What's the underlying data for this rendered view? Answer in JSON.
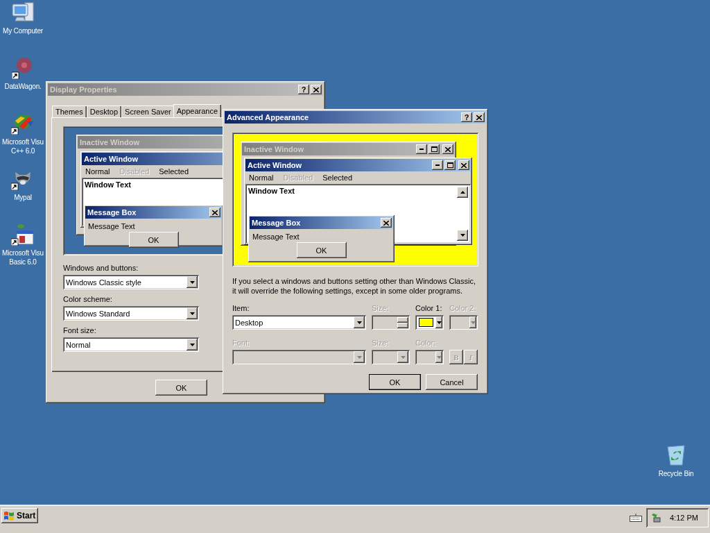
{
  "desktop_icons": [
    {
      "kind": "computer",
      "lines": [
        "My Computer"
      ]
    },
    {
      "kind": "disc",
      "lines": [
        "DataWagon."
      ]
    },
    {
      "kind": "cpp",
      "lines": [
        "Microsoft Visu",
        "C++ 6.0"
      ]
    },
    {
      "kind": "animal",
      "lines": [
        "Mypal"
      ]
    },
    {
      "kind": "vb",
      "lines": [
        "Microsoft Visu",
        "Basic 6.0"
      ]
    }
  ],
  "recycle_bin": {
    "label": "Recycle Bin"
  },
  "display_properties": {
    "title": "Display Properties",
    "active": false,
    "help": "?",
    "tabs": [
      {
        "label": "Themes",
        "selected": false
      },
      {
        "label": "Desktop",
        "selected": false
      },
      {
        "label": "Screen Saver",
        "selected": false
      },
      {
        "label": "Appearance",
        "selected": true
      }
    ],
    "preview": {
      "inactive_title": "Inactive Window",
      "active_title": "Active Window",
      "menu": [
        {
          "label": "Normal",
          "disabled": false
        },
        {
          "label": "Disabled",
          "disabled": true
        },
        {
          "label": "Selected",
          "disabled": false
        }
      ],
      "window_text": "Window Text",
      "message_title": "Message Box",
      "message_text": "Message Text",
      "ok": "OK"
    },
    "fields": [
      {
        "label": "Windows and buttons:",
        "value": "Windows Classic style"
      },
      {
        "label": "Color scheme:",
        "value": "Windows Standard"
      },
      {
        "label": "Font size:",
        "value": "Normal"
      }
    ],
    "buttons": [
      "OK"
    ]
  },
  "advanced_appearance": {
    "title": "Advanced Appearance",
    "active": true,
    "help": "?",
    "preview": {
      "inactive_title": "Inactive Window",
      "active_title": "Active Window",
      "menu": [
        {
          "label": "Normal",
          "disabled": false
        },
        {
          "label": "Disabled",
          "disabled": true
        },
        {
          "label": "Selected",
          "disabled": false
        }
      ],
      "window_text": "Window Text",
      "message_title": "Message Box",
      "message_text": "Message Text",
      "ok": "OK"
    },
    "note_lines": [
      "If you select a windows and buttons setting other than Windows Classic,",
      "it will override the following settings, except in some older programs."
    ],
    "rows": [
      [
        {
          "kind": "dropdown",
          "label": "Item:",
          "value": "Desktop",
          "disabled": false
        },
        {
          "kind": "spinner",
          "label": "Size:",
          "disabled": true
        },
        {
          "kind": "color",
          "label": "Color 1:",
          "disabled": false,
          "color": "#ffff00"
        },
        {
          "kind": "color",
          "label": "Color 2:",
          "disabled": true
        }
      ],
      [
        {
          "kind": "dropdown",
          "label": "Font:",
          "disabled": true
        },
        {
          "kind": "dropdown",
          "label": "Size:",
          "disabled": true
        },
        {
          "kind": "color",
          "label": "Color:",
          "disabled": true
        },
        {
          "kind": "styles",
          "buttons": [
            "B",
            "I"
          ],
          "disabled": true
        }
      ]
    ],
    "buttons": [
      "OK",
      "Cancel"
    ]
  },
  "taskbar": {
    "start": "Start",
    "clock": "4:12 PM"
  }
}
